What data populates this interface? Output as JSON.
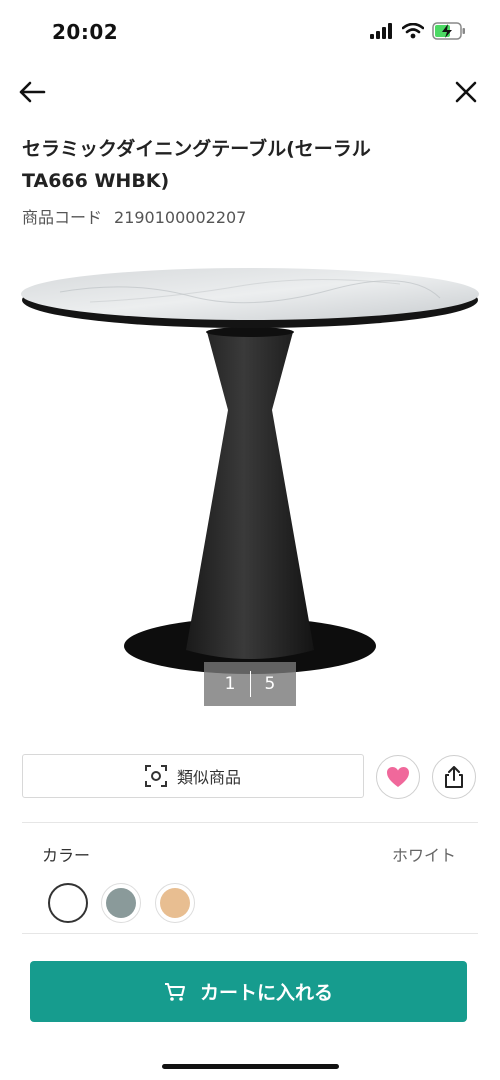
{
  "status_bar": {
    "time": "20:02"
  },
  "nav": {
    "back_icon": "arrow-left-icon",
    "close_icon": "close-icon"
  },
  "product": {
    "title": "セラミックダイニングテーブル(セーラル TA666 WHBK)",
    "code_label": "商品コード",
    "code_value": "2190100002207"
  },
  "gallery": {
    "current": "1",
    "total": "5"
  },
  "actions": {
    "similar_label": "類似商品",
    "favorite_color": "#f0689b"
  },
  "color_selector": {
    "label": "カラー",
    "selected_value": "ホワイト",
    "swatches": [
      {
        "name": "white",
        "color": "#ffffff",
        "selected": true
      },
      {
        "name": "gray",
        "color": "#8a9a9a",
        "selected": false
      },
      {
        "name": "beige",
        "color": "#e8be91",
        "selected": false
      }
    ]
  },
  "cart": {
    "label": "カートに入れる",
    "color": "#169c8e"
  }
}
